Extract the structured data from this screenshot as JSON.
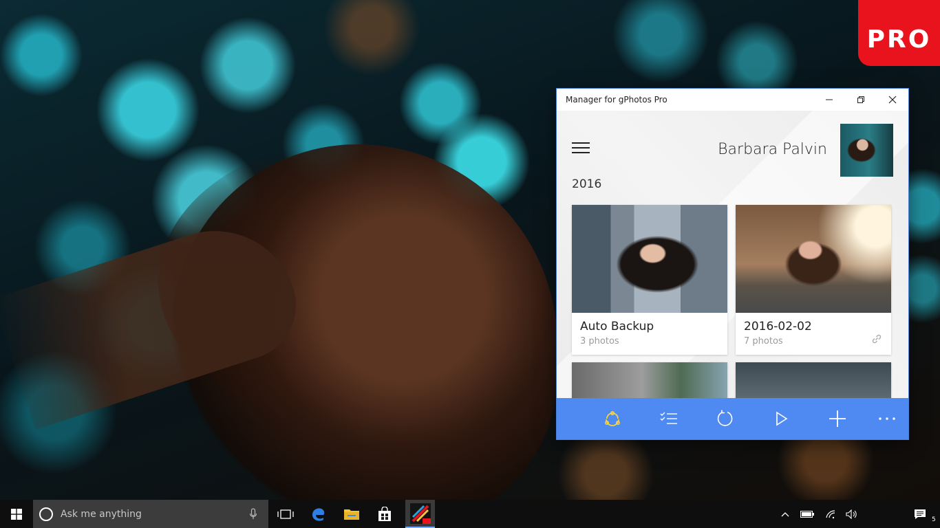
{
  "pro_badge": {
    "label": "PRO"
  },
  "window": {
    "title": "Manager for gPhotos Pro",
    "user_name": "Barbara Palvin",
    "year": "2016"
  },
  "albums": [
    {
      "title": "Auto Backup",
      "count": "3 photos",
      "shared": false
    },
    {
      "title": "2016-02-02",
      "count": "7 photos",
      "shared": true
    },
    {
      "title": "",
      "count": "",
      "shared": false
    },
    {
      "title": "",
      "count": "",
      "shared": false
    }
  ],
  "toolbar": {
    "icons": [
      "upload-icon",
      "select-list-icon",
      "refresh-icon",
      "play-icon",
      "add-icon",
      "more-icon"
    ]
  },
  "taskbar": {
    "search_placeholder": "Ask me anything",
    "notification_count": "5"
  },
  "colors": {
    "accent_bar": "#4f8af2",
    "pro_badge": "#e8131c",
    "taskbar": "#0e0e0e"
  }
}
